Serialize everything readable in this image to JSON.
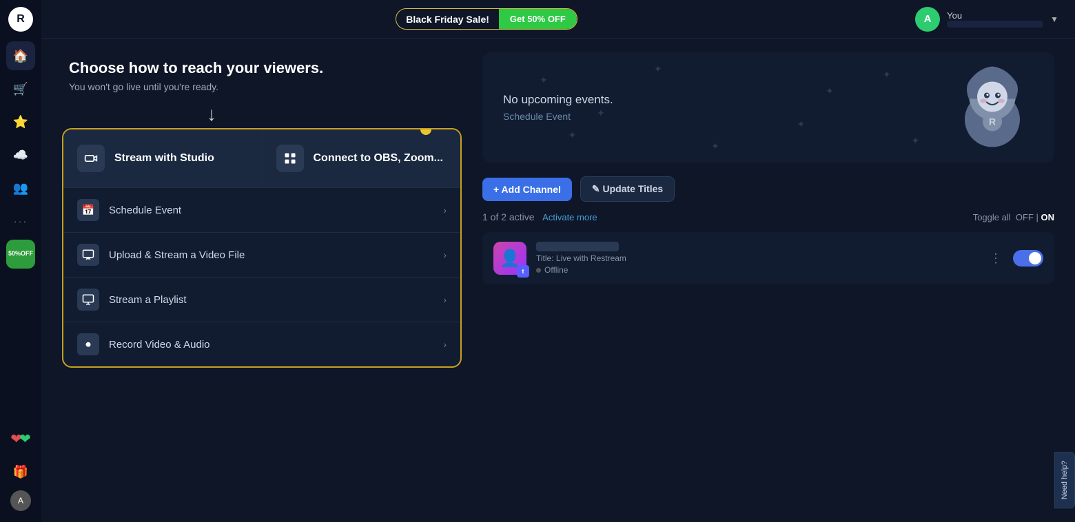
{
  "app": {
    "logo_letter": "R"
  },
  "topbar": {
    "sale_text": "Black Friday Sale!",
    "sale_btn": "Get 50% OFF",
    "user_name": "You",
    "user_avatar_letter": "A",
    "user_email": "••••••••••••"
  },
  "sidebar": {
    "discount_line1": "50%",
    "discount_line2": "OFF",
    "items": [
      {
        "name": "home",
        "icon": "⌂"
      },
      {
        "name": "cart",
        "icon": "🛒"
      },
      {
        "name": "star",
        "icon": "★"
      },
      {
        "name": "cloud",
        "icon": "☁"
      },
      {
        "name": "people",
        "icon": "👥"
      },
      {
        "name": "more",
        "icon": "···"
      }
    ]
  },
  "left_panel": {
    "heading": "Choose how to reach your viewers.",
    "subtext": "You won't go live until you're ready.",
    "options": {
      "stream_with_studio": "Stream with Studio",
      "connect_to_obs": "Connect to OBS, Zoom...",
      "schedule_event": "Schedule Event",
      "upload_stream": "Upload & Stream a Video File",
      "stream_playlist": "Stream a Playlist",
      "record_video": "Record Video & Audio"
    }
  },
  "right_panel": {
    "no_events": "No upcoming events.",
    "schedule_link": "Schedule Event",
    "add_channel_btn": "+ Add Channel",
    "update_titles_btn": "✎ Update Titles",
    "active_label": "1 of 2 active",
    "activate_more": "Activate more",
    "toggle_label": "Toggle all",
    "toggle_off": "OFF",
    "toggle_separator": "|",
    "toggle_on": "ON",
    "channel": {
      "title_label": "Title: Live with Restream",
      "status": "Offline"
    }
  },
  "help": {
    "label": "Need help?"
  }
}
